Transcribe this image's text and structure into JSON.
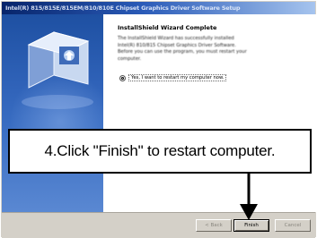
{
  "window": {
    "title": "Intel(R) 815/815E/815EM/810/810E Chipset Graphics Driver Software Setup"
  },
  "wizard": {
    "heading": "InstallShield Wizard Complete",
    "body": "The InstallShield Wizard has successfully installed Intel(R) 810/815 Chipset Graphics Driver Software. Before you can use the program, you must restart your computer.",
    "radio_label": "Yes, I want to restart my computer now."
  },
  "buttons": {
    "back": "< Back",
    "finish": "Finish",
    "cancel": "Cancel"
  },
  "callout": {
    "text": "4.Click \"Finish\" to restart computer."
  },
  "colors": {
    "titlebar_start": "#07246a",
    "titlebar_end": "#a6c4ee",
    "side_panel": "#2f62b8",
    "dialog_face": "#d4d0c8"
  },
  "icons": [
    "installer-box-icon",
    "radio-selected-icon",
    "down-arrow-icon"
  ]
}
